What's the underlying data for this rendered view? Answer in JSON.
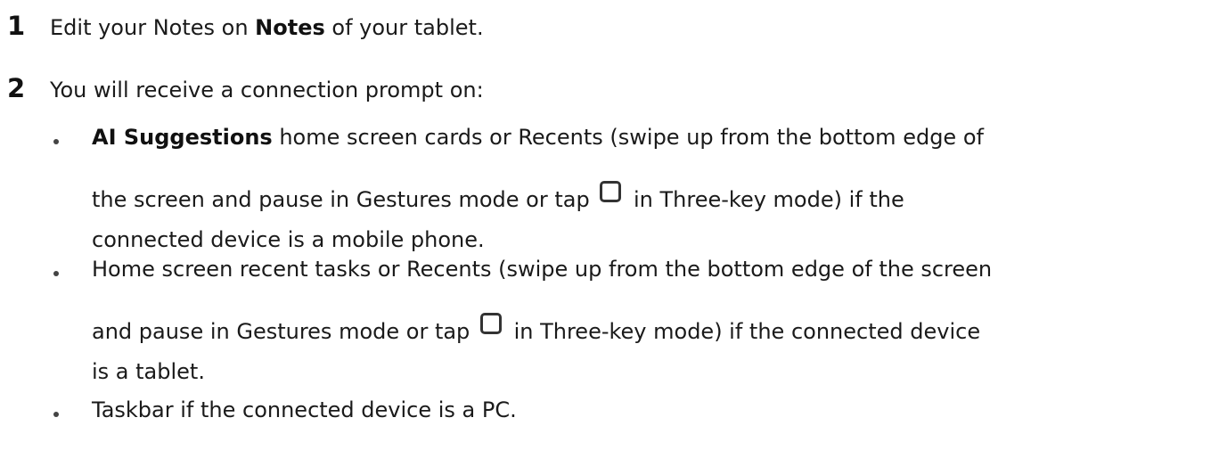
{
  "steps": [
    {
      "number": "1",
      "text_before": "Edit your Notes on ",
      "bold": "Notes",
      "text_after": " of your tablet."
    },
    {
      "number": "2",
      "text": "You will receive a connection prompt on:"
    }
  ],
  "bullets": [
    {
      "bold": "AI Suggestions",
      "line1_rest": " home screen cards or Recents (swipe up from the bottom edge of",
      "line2_before": "the screen and pause in Gestures mode or tap",
      "line2_after": "in Three-key mode) if the",
      "line3": "connected device is a mobile phone."
    },
    {
      "line1": "Home screen recent tasks or Recents (swipe up from the bottom edge of the screen",
      "line2_before": "and pause in Gestures mode or tap",
      "line2_after": "in Three-key mode) if the connected device",
      "line3": "is a tablet."
    },
    {
      "line1": "Taskbar if the connected device is a PC."
    }
  ],
  "icons": {
    "recents": "recents-key-icon",
    "bullet": "bullet-dot-icon"
  },
  "colors": {
    "text": "#1a1a1a",
    "icon_stroke": "#333333"
  }
}
